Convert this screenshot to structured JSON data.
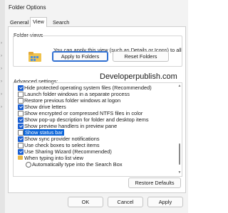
{
  "window": {
    "title": "Folder Options"
  },
  "tabs": [
    {
      "label": "General"
    },
    {
      "label": "View"
    },
    {
      "label": "Search"
    }
  ],
  "folder_views": {
    "label": "Folder views",
    "description": "You can apply this view (such as Details or Icons) to all folders of this type.",
    "apply_button": "Apply to Folders",
    "reset_button": "Reset Folders"
  },
  "watermark": "Developerpublish.com",
  "advanced": {
    "label": "Advanced settings:",
    "items": [
      {
        "label": "Hide protected operating system files (Recommended)",
        "checked": true
      },
      {
        "label": "Launch folder windows in a separate process",
        "checked": false
      },
      {
        "label": "Restore previous folder windows at logon",
        "checked": false
      },
      {
        "label": "Show drive letters",
        "checked": true
      },
      {
        "label": "Show encrypted or compressed NTFS files in color",
        "checked": false
      },
      {
        "label": "Show pop-up description for folder and desktop items",
        "checked": true
      },
      {
        "label": "Show preview handlers in preview pane",
        "checked": true
      },
      {
        "label": "Show status bar",
        "checked": false,
        "selected": true
      },
      {
        "label": "Show sync provider notifications",
        "checked": true
      },
      {
        "label": "Use check boxes to select items",
        "checked": false
      },
      {
        "label": "Use Sharing Wizard (Recommended)",
        "checked": true
      },
      {
        "label": "When typing into list view",
        "type": "folder"
      },
      {
        "label": "Automatically type into the Search Box",
        "type": "radio"
      }
    ]
  },
  "restore_defaults": "Restore Defaults",
  "footer": {
    "ok": "OK",
    "cancel": "Cancel",
    "apply": "Apply"
  },
  "colors": {
    "accent": "#1b5fd1",
    "selection": "#0a64d8",
    "folder": "#e8b84a"
  }
}
